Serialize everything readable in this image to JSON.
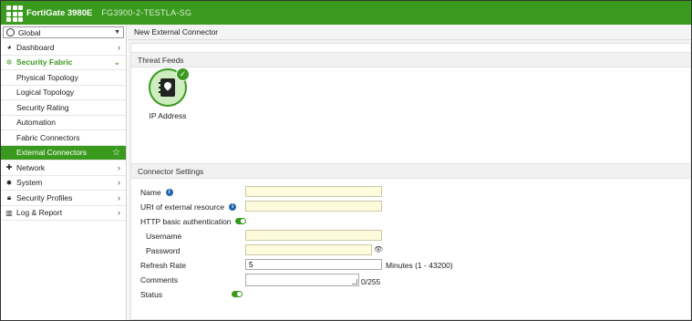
{
  "header": {
    "product": "FortiGate 3980E",
    "hostname": "FG3900-2-TESTLA-SG"
  },
  "sidebar": {
    "vdom": "Global",
    "items": [
      {
        "label": "Dashboard",
        "icon": "dashboard-icon"
      },
      {
        "label": "Security Fabric",
        "icon": "fabric-icon"
      },
      {
        "label": "Physical Topology"
      },
      {
        "label": "Logical Topology"
      },
      {
        "label": "Security Rating"
      },
      {
        "label": "Automation"
      },
      {
        "label": "Fabric Connectors"
      },
      {
        "label": "External Connectors"
      },
      {
        "label": "Network",
        "icon": "network-icon"
      },
      {
        "label": "System",
        "icon": "gear-icon"
      },
      {
        "label": "Security Profiles",
        "icon": "lock-icon"
      },
      {
        "label": "Log & Report",
        "icon": "bar-chart-icon"
      }
    ]
  },
  "main": {
    "title": "New External Connector",
    "threat_feeds_heading": "Threat Feeds",
    "feed_label": "IP Address",
    "connector_settings_heading": "Connector Settings",
    "form": {
      "name_label": "Name",
      "name_value": "",
      "uri_label": "URI of external resource",
      "uri_value": "",
      "http_auth_label": "HTTP basic authentication",
      "username_label": "Username",
      "username_value": "",
      "password_label": "Password",
      "password_value": "",
      "refresh_label": "Refresh Rate",
      "refresh_value": "5",
      "refresh_suffix": "Minutes (1 - 43200)",
      "comments_label": "Comments",
      "comments_value": "",
      "comments_counter": "0/255",
      "status_label": "Status"
    }
  },
  "colors": {
    "brand_green": "#3a9a1e",
    "input_yellow": "#fdfbdc"
  }
}
